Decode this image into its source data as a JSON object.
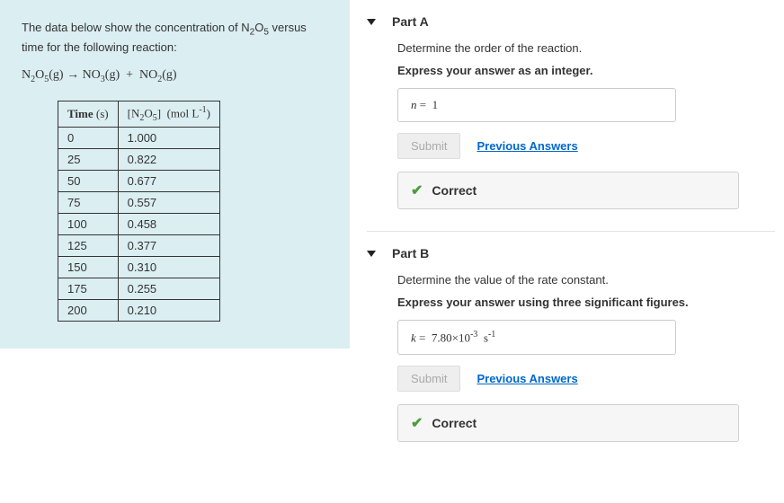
{
  "problem": {
    "intro_html_prefix": "The data below show the concentration of ",
    "intro_html_suffix": " versus time for the following reaction:",
    "compound_plain": "N2O5",
    "equation_plain": "N2O5(g) → NO3(g) + NO2(g)",
    "table": {
      "col1_header": "Time (s)",
      "col2_header_prefix": "[N2O5]  (mol L",
      "col2_header_exponent": "-1",
      "col2_header_suffix": ")",
      "rows": [
        {
          "time": "0",
          "conc": "1.000"
        },
        {
          "time": "25",
          "conc": "0.822"
        },
        {
          "time": "50",
          "conc": "0.677"
        },
        {
          "time": "75",
          "conc": "0.557"
        },
        {
          "time": "100",
          "conc": "0.458"
        },
        {
          "time": "125",
          "conc": "0.377"
        },
        {
          "time": "150",
          "conc": "0.310"
        },
        {
          "time": "175",
          "conc": "0.255"
        },
        {
          "time": "200",
          "conc": "0.210"
        }
      ]
    }
  },
  "partA": {
    "title": "Part A",
    "question": "Determine the order of the reaction.",
    "hint": "Express your answer as an integer.",
    "answer_var": "n",
    "answer_equals": "=",
    "answer_value": "1",
    "submit_label": "Submit",
    "prev_label": "Previous Answers",
    "feedback": "Correct"
  },
  "partB": {
    "title": "Part B",
    "question": "Determine the value of the rate constant.",
    "hint": "Express your answer using three significant figures.",
    "answer_var": "k",
    "answer_equals": "=",
    "answer_value": "7.80×10",
    "answer_exp": "-3",
    "answer_unit_base": "s",
    "answer_unit_exp": "-1",
    "submit_label": "Submit",
    "prev_label": "Previous Answers",
    "feedback": "Correct"
  }
}
